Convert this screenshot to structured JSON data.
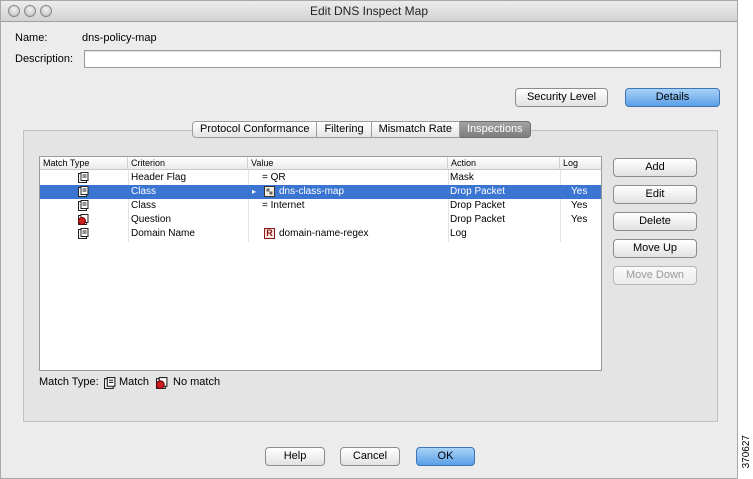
{
  "window": {
    "title": "Edit DNS Inspect Map"
  },
  "form": {
    "name_label": "Name:",
    "name_value": "dns-policy-map",
    "description_label": "Description:",
    "description_value": ""
  },
  "buttons": {
    "security_level": "Security Level",
    "details": "Details",
    "add": "Add",
    "edit": "Edit",
    "delete": "Delete",
    "move_up": "Move Up",
    "move_down": "Move Down",
    "help": "Help",
    "cancel": "Cancel",
    "ok": "OK"
  },
  "tabs": [
    {
      "label": "Protocol Conformance",
      "active": false
    },
    {
      "label": "Filtering",
      "active": false
    },
    {
      "label": "Mismatch Rate",
      "active": false
    },
    {
      "label": "Inspections",
      "active": true
    }
  ],
  "table": {
    "columns": [
      "Match Type",
      "Criterion",
      "Value",
      "Action",
      "Log"
    ],
    "rows": [
      {
        "match_icon": "match-icon",
        "criterion": "Header Flag",
        "value_prefix": "= QR",
        "value_icon": "",
        "value": "",
        "action": "Mask",
        "log": "",
        "selected": false
      },
      {
        "match_icon": "match-icon",
        "criterion": "Class",
        "value_prefix": "",
        "value_icon": "class-map-icon",
        "value": "dns-class-map",
        "action": "Drop Packet",
        "log": "Yes",
        "selected": true
      },
      {
        "match_icon": "match-icon",
        "criterion": "Class",
        "value_prefix": "= Internet",
        "value_icon": "",
        "value": "",
        "action": "Drop Packet",
        "log": "Yes",
        "selected": false
      },
      {
        "match_icon": "no-match-icon",
        "criterion": "Question",
        "value_prefix": "",
        "value_icon": "",
        "value": "",
        "action": "Drop Packet",
        "log": "Yes",
        "selected": false
      },
      {
        "match_icon": "match-icon",
        "criterion": "Domain Name",
        "value_prefix": "",
        "value_icon": "regex-icon",
        "value": "domain-name-regex",
        "action": "Log",
        "log": "",
        "selected": false
      }
    ]
  },
  "legend": {
    "label": "Match Type:",
    "match": "Match",
    "no_match": "No match"
  },
  "figure_id": "370627",
  "colors": {
    "selection": "#3b75d2",
    "default_button": "#5a9ee8"
  }
}
